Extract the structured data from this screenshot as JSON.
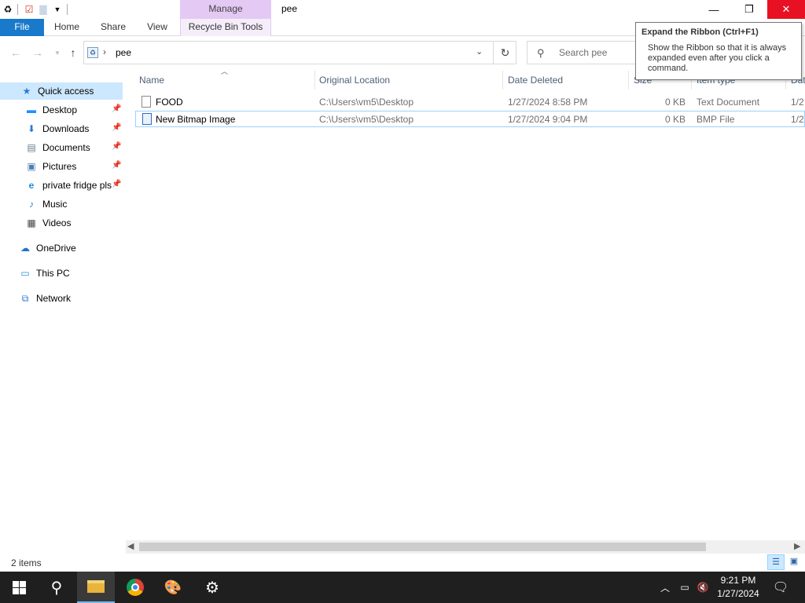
{
  "window": {
    "title": "pee",
    "context_tab_group": "Manage",
    "minimize_glyph": "—",
    "maximize_glyph": "❐",
    "close_glyph": "✕"
  },
  "ribbon": {
    "tabs": [
      {
        "label": "File"
      },
      {
        "label": "Home"
      },
      {
        "label": "Share"
      },
      {
        "label": "View"
      },
      {
        "label": "Recycle Bin Tools"
      }
    ]
  },
  "address": {
    "path": "pee",
    "search_placeholder": "Search pee"
  },
  "tooltip": {
    "title": "Expand the Ribbon (Ctrl+F1)",
    "body": "Show the Ribbon so that it is always expanded even after you click a command."
  },
  "nav_pane": {
    "items": [
      {
        "label": "Quick access",
        "icon": "star-icon",
        "pinned": false
      },
      {
        "label": "Desktop",
        "icon": "desktop-icon",
        "pinned": true
      },
      {
        "label": "Downloads",
        "icon": "download-icon",
        "pinned": true
      },
      {
        "label": "Documents",
        "icon": "documents-icon",
        "pinned": true
      },
      {
        "label": "Pictures",
        "icon": "pictures-icon",
        "pinned": true
      },
      {
        "label": "private fridge pls",
        "icon": "edge-icon",
        "pinned": true
      },
      {
        "label": "Music",
        "icon": "music-icon",
        "pinned": false
      },
      {
        "label": "Videos",
        "icon": "videos-icon",
        "pinned": false
      },
      {
        "label": "OneDrive",
        "icon": "cloud-icon",
        "pinned": false
      },
      {
        "label": "This PC",
        "icon": "computer-icon",
        "pinned": false
      },
      {
        "label": "Network",
        "icon": "network-icon",
        "pinned": false
      }
    ]
  },
  "columns": {
    "name": "Name",
    "original_location": "Original Location",
    "date_deleted": "Date Deleted",
    "size": "Size",
    "item_type": "Item type",
    "date_modified": "Dat"
  },
  "rows": [
    {
      "name": "FOOD",
      "original_location": "C:\\Users\\vm5\\Desktop",
      "date_deleted": "1/27/2024 8:58 PM",
      "size": "0 KB",
      "item_type": "Text Document",
      "date_modified": "1/2"
    },
    {
      "name": "New Bitmap Image",
      "original_location": "C:\\Users\\vm5\\Desktop",
      "date_deleted": "1/27/2024 9:04 PM",
      "size": "0 KB",
      "item_type": "BMP File",
      "date_modified": "1/2"
    }
  ],
  "status": {
    "item_count": "2 items"
  },
  "taskbar": {
    "time": "9:21 PM",
    "date": "1/27/2024"
  }
}
